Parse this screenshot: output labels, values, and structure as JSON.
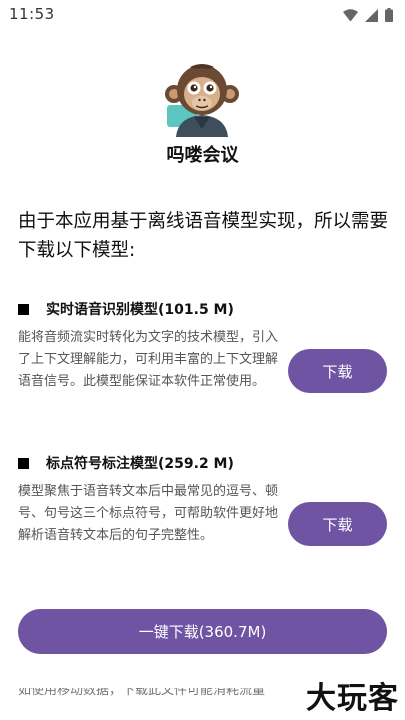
{
  "status_bar": {
    "time": "11:53",
    "icons": [
      "wifi-icon",
      "signal-icon",
      "battery-icon"
    ]
  },
  "header": {
    "app_name": "吗喽会议",
    "avatar_icon": "monkey-avatar-icon"
  },
  "intro": "由于本应用基于离线语音模型实现，所以需要下载以下模型:",
  "models": [
    {
      "name": "实时语音识别模型(101.5 M)",
      "description": "能将音频流实时转化为文字的技术模型，引入了上下文理解能力，可利用丰富的上下文理解语音信号。此模型能保证本软件正常使用。",
      "button_label": "下载"
    },
    {
      "name": "标点符号标注模型(259.2 M)",
      "description": "模型聚焦于语音转文本后中最常见的逗号、顿号、句号这三个标点符号，可帮助软件更好地解析语音转文本后的句子完整性。",
      "button_label": "下载"
    }
  ],
  "download_all_label": "一键下载(360.7M)",
  "footer_note": "如使用移动数据，下载此文件可能消耗流量",
  "watermark": "大玩客",
  "colors": {
    "accent": "#6e54a3",
    "text_primary": "#111111",
    "text_secondary": "#555555"
  }
}
